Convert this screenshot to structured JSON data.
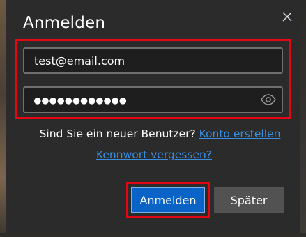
{
  "dialog": {
    "title": "Anmelden",
    "close_icon": "close-icon"
  },
  "form": {
    "email_value": "test@email.com",
    "password_masked": "●●●●●●●●●●●●",
    "password_length": 12,
    "reveal_icon": "eye-icon"
  },
  "new_user": {
    "question": "Sind Sie ein neuer Benutzer?",
    "create_link": "Konto erstellen"
  },
  "forgot_link": "Kennwort vergessen?",
  "buttons": {
    "signin": "Anmelden",
    "later": "Später"
  },
  "colors": {
    "accent": "#0a64c8",
    "link": "#3a8fe0",
    "highlight": "#e30613",
    "dialog_bg": "#2b2b2b"
  }
}
